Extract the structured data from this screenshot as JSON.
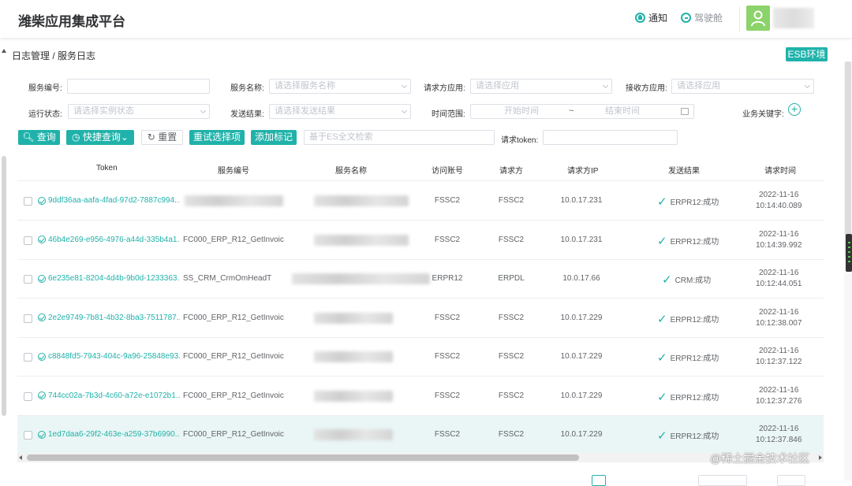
{
  "app": {
    "title": "潍柴应用集成平台"
  },
  "topbar": {
    "notify_label": "通知",
    "cockpit_label": "驾驶舱"
  },
  "breadcrumb": "日志管理 / 服务日志",
  "env_button": "ESB环境",
  "filters": {
    "service_no_label": "服务编号:",
    "service_no_value": "",
    "service_name_label": "服务名称:",
    "service_name_placeholder": "请选择服务名称",
    "request_app_label": "请求方应用:",
    "request_app_placeholder": "请选择应用",
    "receive_app_label": "接收方应用:",
    "receive_app_placeholder": "请选择应用",
    "run_status_label": "运行状态:",
    "run_status_placeholder": "请选择实例状态",
    "send_result_label": "发送结果:",
    "send_result_placeholder": "请选择发送结果",
    "time_range_label": "时间范围:",
    "start_placeholder": "开始时间",
    "range_sep": "~",
    "end_placeholder": "结束时间",
    "biz_key_label": "业务关键字:",
    "biz_key_add": "+"
  },
  "actions": {
    "query": "查询",
    "quick_query": "快捷查询",
    "reset": "重置",
    "retry_selected": "重试选择项",
    "add_mark": "添加标记",
    "es_search_placeholder": "基于ES全文检索",
    "token_label": "请求token:",
    "token_value": ""
  },
  "table": {
    "columns": [
      "Token",
      "服务编号",
      "服务名称",
      "访问账号",
      "请求方",
      "请求方IP",
      "发送结果",
      "请求时间"
    ],
    "rows": [
      {
        "token": "9ddf36aa-aafa-4fad-97d2-7887c994...",
        "service_no": "",
        "account": "FSSC2",
        "requester": "FSSC2",
        "ip": "10.0.17.231",
        "result": "ERPR12:成功",
        "date": "2022-11-16",
        "time": "10:14:40.089"
      },
      {
        "token": "46b4e269-e956-4976-a44d-335b4a1...",
        "service_no": "FC000_ERP_R12_GetInvoice...",
        "account": "FSSC2",
        "requester": "FSSC2",
        "ip": "10.0.17.231",
        "result": "ERPR12:成功",
        "date": "2022-11-16",
        "time": "10:14:39.992"
      },
      {
        "token": "6e235e81-8204-4d4b-9b0d-1233363...",
        "service_no": "SS_CRM_CrmOmHeadT",
        "account": "ERPR12",
        "requester": "ERPDL",
        "ip": "10.0.17.66",
        "result": "CRM:成功",
        "date": "2022-11-16",
        "time": "10:12:44.051"
      },
      {
        "token": "2e2e9749-7b81-4b32-8ba3-7511787...",
        "service_no": "FC000_ERP_R12_GetInvoice...",
        "account": "FSSC2",
        "requester": "FSSC2",
        "ip": "10.0.17.229",
        "result": "ERPR12:成功",
        "date": "2022-11-16",
        "time": "10:12:38.007"
      },
      {
        "token": "c8848fd5-7943-404c-9a96-25848e93...",
        "service_no": "FC000_ERP_R12_GetInvoice...",
        "account": "FSSC2",
        "requester": "FSSC2",
        "ip": "10.0.17.229",
        "result": "ERPR12:成功",
        "date": "2022-11-16",
        "time": "10:12:37.122"
      },
      {
        "token": "744cc02a-7b3d-4c60-a72e-e1072b1...",
        "service_no": "FC000_ERP_R12_GetInvoice...",
        "account": "FSSC2",
        "requester": "FSSC2",
        "ip": "10.0.17.229",
        "result": "ERPR12:成功",
        "date": "2022-11-16",
        "time": "10:12:37.276"
      },
      {
        "token": "1ed7daa6-29f2-463e-a259-37b6990...",
        "service_no": "FC000_ERP_R12_GetInvoice...",
        "account": "FSSC2",
        "requester": "FSSC2",
        "ip": "10.0.17.229",
        "result": "ERPR12:成功",
        "date": "2022-11-16",
        "time": "10:12:37.846"
      }
    ]
  },
  "watermark": "@稀土掘金技术社区",
  "colors": {
    "accent": "#20b2aa",
    "highlight_row": "#eaf6f5"
  }
}
